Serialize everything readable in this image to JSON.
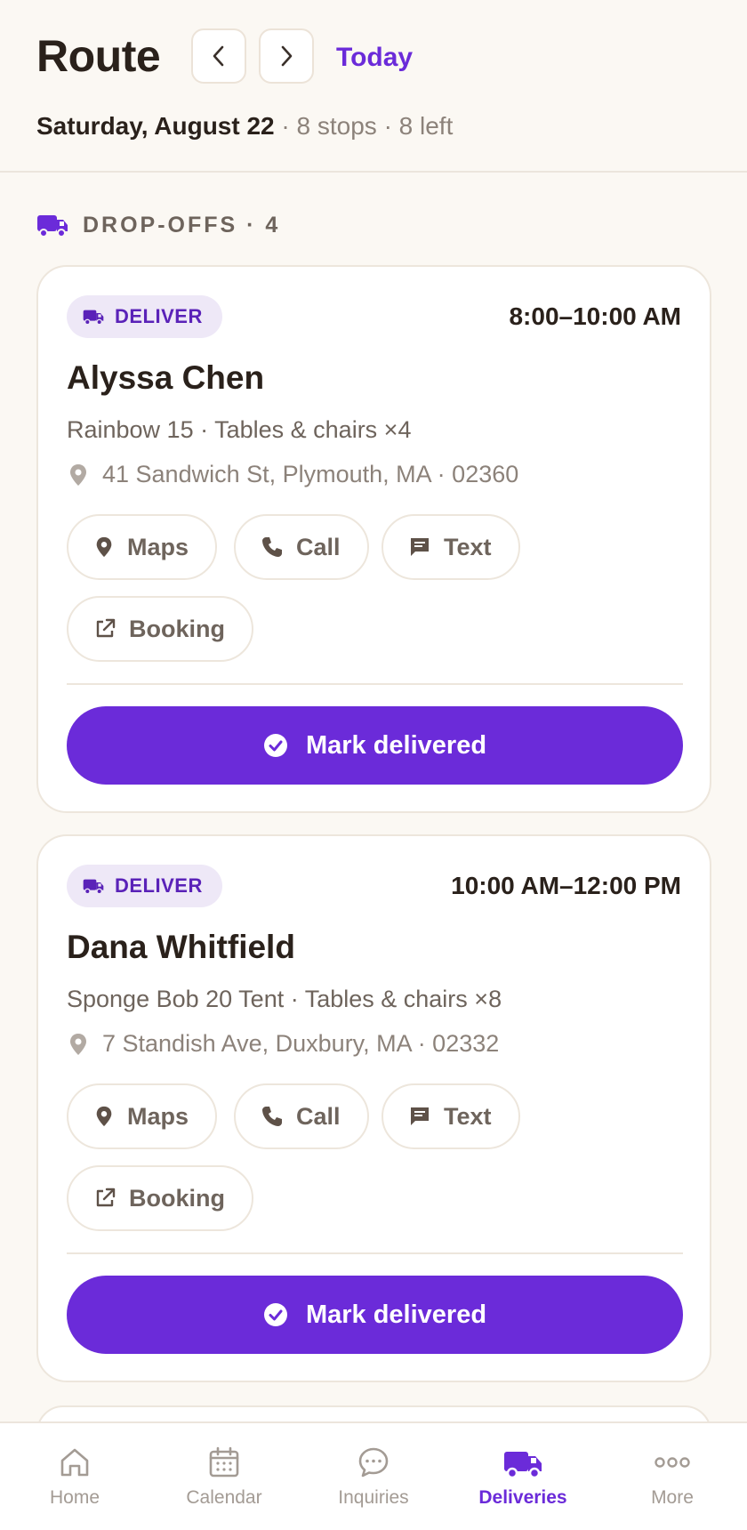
{
  "header": {
    "title": "Route",
    "today_label": "Today",
    "date": "Saturday, August 22",
    "meta": " · 8 stops · 8 left"
  },
  "section": {
    "label": "DROP-OFFS · 4"
  },
  "cards": [
    {
      "badge": "DELIVER",
      "window": "8:00–10:00 AM",
      "customer": "Alyssa Chen",
      "items": "Rainbow 15 · Tables & chairs ×4",
      "address": "41 Sandwich St, Plymouth, MA · 02360",
      "actions": {
        "maps": "Maps",
        "call": "Call",
        "text": "Text",
        "booking": "Booking"
      },
      "primary": "Mark delivered"
    },
    {
      "badge": "DELIVER",
      "window": "10:00 AM–12:00 PM",
      "customer": "Dana Whitfield",
      "items": "Sponge Bob 20 Tent · Tables & chairs ×8",
      "address": "7 Standish Ave, Duxbury, MA · 02332",
      "actions": {
        "maps": "Maps",
        "call": "Call",
        "text": "Text",
        "booking": "Booking"
      },
      "primary": "Mark delivered"
    }
  ],
  "tabbar": {
    "tabs": [
      {
        "label": "Home",
        "icon": "home-icon"
      },
      {
        "label": "Calendar",
        "icon": "calendar-icon"
      },
      {
        "label": "Inquiries",
        "icon": "chat-icon"
      },
      {
        "label": "Deliveries",
        "icon": "truck-icon",
        "active": true
      },
      {
        "label": "More",
        "icon": "more-icon"
      }
    ]
  },
  "colors": {
    "accent": "#6B2BD9",
    "background": "#FBF8F3",
    "badge_bg": "#EEE8F7",
    "muted_text": "#8C827A"
  }
}
